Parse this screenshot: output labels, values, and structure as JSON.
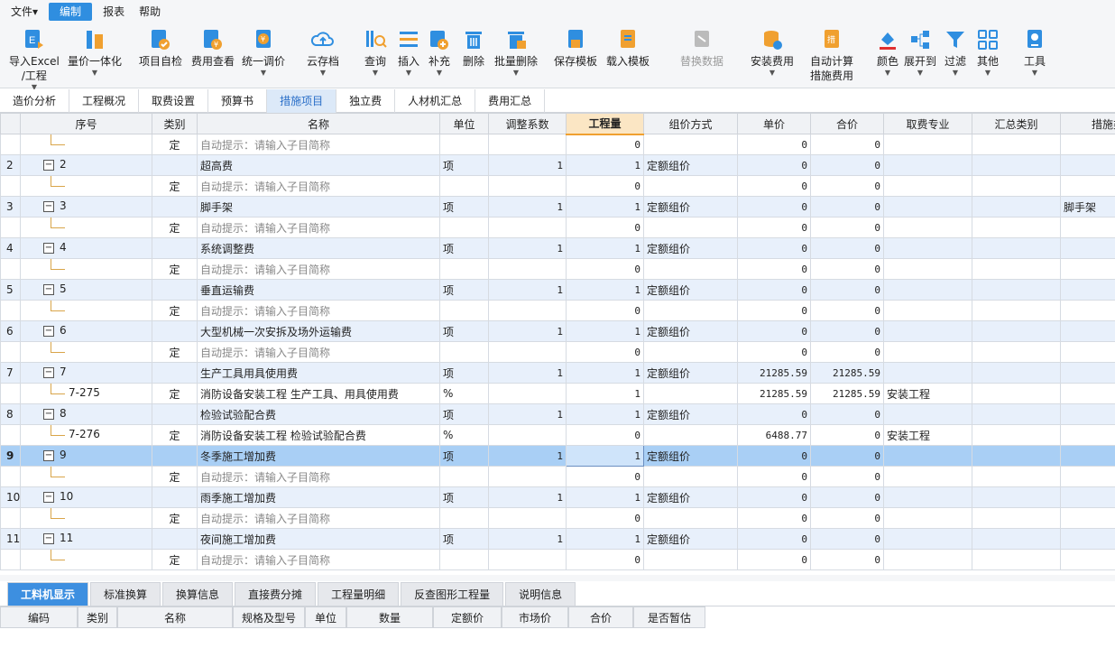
{
  "menubar": {
    "file": "文件",
    "edit": "编制",
    "report": "报表",
    "help": "帮助"
  },
  "ribbon": {
    "import_excel": "导入Excel\n/工程",
    "price_integration": "量价一体化",
    "self_check": "项目自检",
    "fee_view": "费用查看",
    "unified_adjust": "统一调价",
    "cloud_save": "云存档",
    "query": "查询",
    "insert": "插入",
    "supplement": "补充",
    "delete": "删除",
    "batch_delete": "批量删除",
    "save_template": "保存模板",
    "load_template": "载入模板",
    "replace_data": "替换数据",
    "install_fee": "安装费用",
    "auto_calc": "自动计算\n措施费用",
    "color": "颜色",
    "expand_to": "展开到",
    "filter": "过滤",
    "other": "其他",
    "tools": "工具"
  },
  "tabs": [
    "造价分析",
    "工程概况",
    "取费设置",
    "预算书",
    "措施项目",
    "独立费",
    "人材机汇总",
    "费用汇总"
  ],
  "grid": {
    "headers": [
      "序号",
      "类别",
      "名称",
      "单位",
      "调整系数",
      "工程量",
      "组价方式",
      "单价",
      "合价",
      "取费专业",
      "汇总类别",
      "措施类"
    ],
    "rows": [
      {
        "no": "",
        "code": "",
        "cat": "定",
        "name": "自动提示：请输入子目简称",
        "unit": "",
        "coef": "",
        "qty": "0",
        "method": "",
        "price": "0",
        "total": "0",
        "prof": "",
        "sum": "",
        "meas": "",
        "type": "child"
      },
      {
        "no": "2",
        "code": "2",
        "cat": "",
        "name": "超高费",
        "unit": "项",
        "coef": "1",
        "qty": "1",
        "method": "定额组价",
        "price": "0",
        "total": "0",
        "prof": "",
        "sum": "",
        "meas": "",
        "type": "main"
      },
      {
        "no": "",
        "code": "",
        "cat": "定",
        "name": "自动提示：请输入子目简称",
        "unit": "",
        "coef": "",
        "qty": "0",
        "method": "",
        "price": "0",
        "total": "0",
        "prof": "",
        "sum": "",
        "meas": "",
        "type": "child"
      },
      {
        "no": "3",
        "code": "3",
        "cat": "",
        "name": "脚手架",
        "unit": "项",
        "coef": "1",
        "qty": "1",
        "method": "定额组价",
        "price": "0",
        "total": "0",
        "prof": "",
        "sum": "",
        "meas": "脚手架",
        "type": "main"
      },
      {
        "no": "",
        "code": "",
        "cat": "定",
        "name": "自动提示：请输入子目简称",
        "unit": "",
        "coef": "",
        "qty": "0",
        "method": "",
        "price": "0",
        "total": "0",
        "prof": "",
        "sum": "",
        "meas": "",
        "type": "child"
      },
      {
        "no": "4",
        "code": "4",
        "cat": "",
        "name": "系统调整费",
        "unit": "项",
        "coef": "1",
        "qty": "1",
        "method": "定额组价",
        "price": "0",
        "total": "0",
        "prof": "",
        "sum": "",
        "meas": "",
        "type": "main"
      },
      {
        "no": "",
        "code": "",
        "cat": "定",
        "name": "自动提示：请输入子目简称",
        "unit": "",
        "coef": "",
        "qty": "0",
        "method": "",
        "price": "0",
        "total": "0",
        "prof": "",
        "sum": "",
        "meas": "",
        "type": "child"
      },
      {
        "no": "5",
        "code": "5",
        "cat": "",
        "name": "垂直运输费",
        "unit": "项",
        "coef": "1",
        "qty": "1",
        "method": "定额组价",
        "price": "0",
        "total": "0",
        "prof": "",
        "sum": "",
        "meas": "",
        "type": "main"
      },
      {
        "no": "",
        "code": "",
        "cat": "定",
        "name": "自动提示：请输入子目简称",
        "unit": "",
        "coef": "",
        "qty": "0",
        "method": "",
        "price": "0",
        "total": "0",
        "prof": "",
        "sum": "",
        "meas": "",
        "type": "child"
      },
      {
        "no": "6",
        "code": "6",
        "cat": "",
        "name": "大型机械一次安拆及场外运输费",
        "unit": "项",
        "coef": "1",
        "qty": "1",
        "method": "定额组价",
        "price": "0",
        "total": "0",
        "prof": "",
        "sum": "",
        "meas": "",
        "type": "main"
      },
      {
        "no": "",
        "code": "",
        "cat": "定",
        "name": "自动提示：请输入子目简称",
        "unit": "",
        "coef": "",
        "qty": "0",
        "method": "",
        "price": "0",
        "total": "0",
        "prof": "",
        "sum": "",
        "meas": "",
        "type": "child"
      },
      {
        "no": "7",
        "code": "7",
        "cat": "",
        "name": "生产工具用具使用费",
        "unit": "项",
        "coef": "1",
        "qty": "1",
        "method": "定额组价",
        "price": "21285.59",
        "total": "21285.59",
        "prof": "",
        "sum": "",
        "meas": "",
        "type": "main"
      },
      {
        "no": "",
        "code": "7-275",
        "cat": "定",
        "name": "消防设备安装工程 生产工具、用具使用费",
        "unit": "%",
        "coef": "",
        "qty": "1",
        "method": "",
        "price": "21285.59",
        "total": "21285.59",
        "prof": "安装工程",
        "sum": "",
        "meas": "",
        "type": "child-real"
      },
      {
        "no": "8",
        "code": "8",
        "cat": "",
        "name": "检验试验配合费",
        "unit": "项",
        "coef": "1",
        "qty": "1",
        "method": "定额组价",
        "price": "0",
        "total": "0",
        "prof": "",
        "sum": "",
        "meas": "",
        "type": "main"
      },
      {
        "no": "",
        "code": "7-276",
        "cat": "定",
        "name": "消防设备安装工程 检验试验配合费",
        "unit": "%",
        "coef": "",
        "qty": "0",
        "method": "",
        "price": "6488.77",
        "total": "0",
        "prof": "安装工程",
        "sum": "",
        "meas": "",
        "type": "child-real"
      },
      {
        "no": "9",
        "code": "9",
        "cat": "",
        "name": "冬季施工增加费",
        "unit": "项",
        "coef": "1",
        "qty": "1",
        "method": "定额组价",
        "price": "0",
        "total": "0",
        "prof": "",
        "sum": "",
        "meas": "",
        "type": "selected"
      },
      {
        "no": "",
        "code": "",
        "cat": "定",
        "name": "自动提示：请输入子目简称",
        "unit": "",
        "coef": "",
        "qty": "0",
        "method": "",
        "price": "0",
        "total": "0",
        "prof": "",
        "sum": "",
        "meas": "",
        "type": "child"
      },
      {
        "no": "10",
        "code": "10",
        "cat": "",
        "name": "雨季施工增加费",
        "unit": "项",
        "coef": "1",
        "qty": "1",
        "method": "定额组价",
        "price": "0",
        "total": "0",
        "prof": "",
        "sum": "",
        "meas": "",
        "type": "main"
      },
      {
        "no": "",
        "code": "",
        "cat": "定",
        "name": "自动提示：请输入子目简称",
        "unit": "",
        "coef": "",
        "qty": "0",
        "method": "",
        "price": "0",
        "total": "0",
        "prof": "",
        "sum": "",
        "meas": "",
        "type": "child"
      },
      {
        "no": "11",
        "code": "11",
        "cat": "",
        "name": "夜间施工增加费",
        "unit": "项",
        "coef": "1",
        "qty": "1",
        "method": "定额组价",
        "price": "0",
        "total": "0",
        "prof": "",
        "sum": "",
        "meas": "",
        "type": "main"
      },
      {
        "no": "",
        "code": "",
        "cat": "定",
        "name": "自动提示：请输入子目简称",
        "unit": "",
        "coef": "",
        "qty": "0",
        "method": "",
        "price": "0",
        "total": "0",
        "prof": "",
        "sum": "",
        "meas": "",
        "type": "child"
      }
    ]
  },
  "bottom_tabs": [
    "工料机显示",
    "标准换算",
    "换算信息",
    "直接费分摊",
    "工程量明细",
    "反查图形工程量",
    "说明信息"
  ],
  "detail_headers": [
    "编码",
    "类别",
    "名称",
    "规格及型号",
    "单位",
    "数量",
    "定额价",
    "市场价",
    "合价",
    "是否暂估"
  ],
  "colors": {
    "accent": "#2f8ee0",
    "selected_row": "#a9cff5",
    "main_row": "#e8f0fb",
    "highlight_header": "#fbe6c4"
  }
}
